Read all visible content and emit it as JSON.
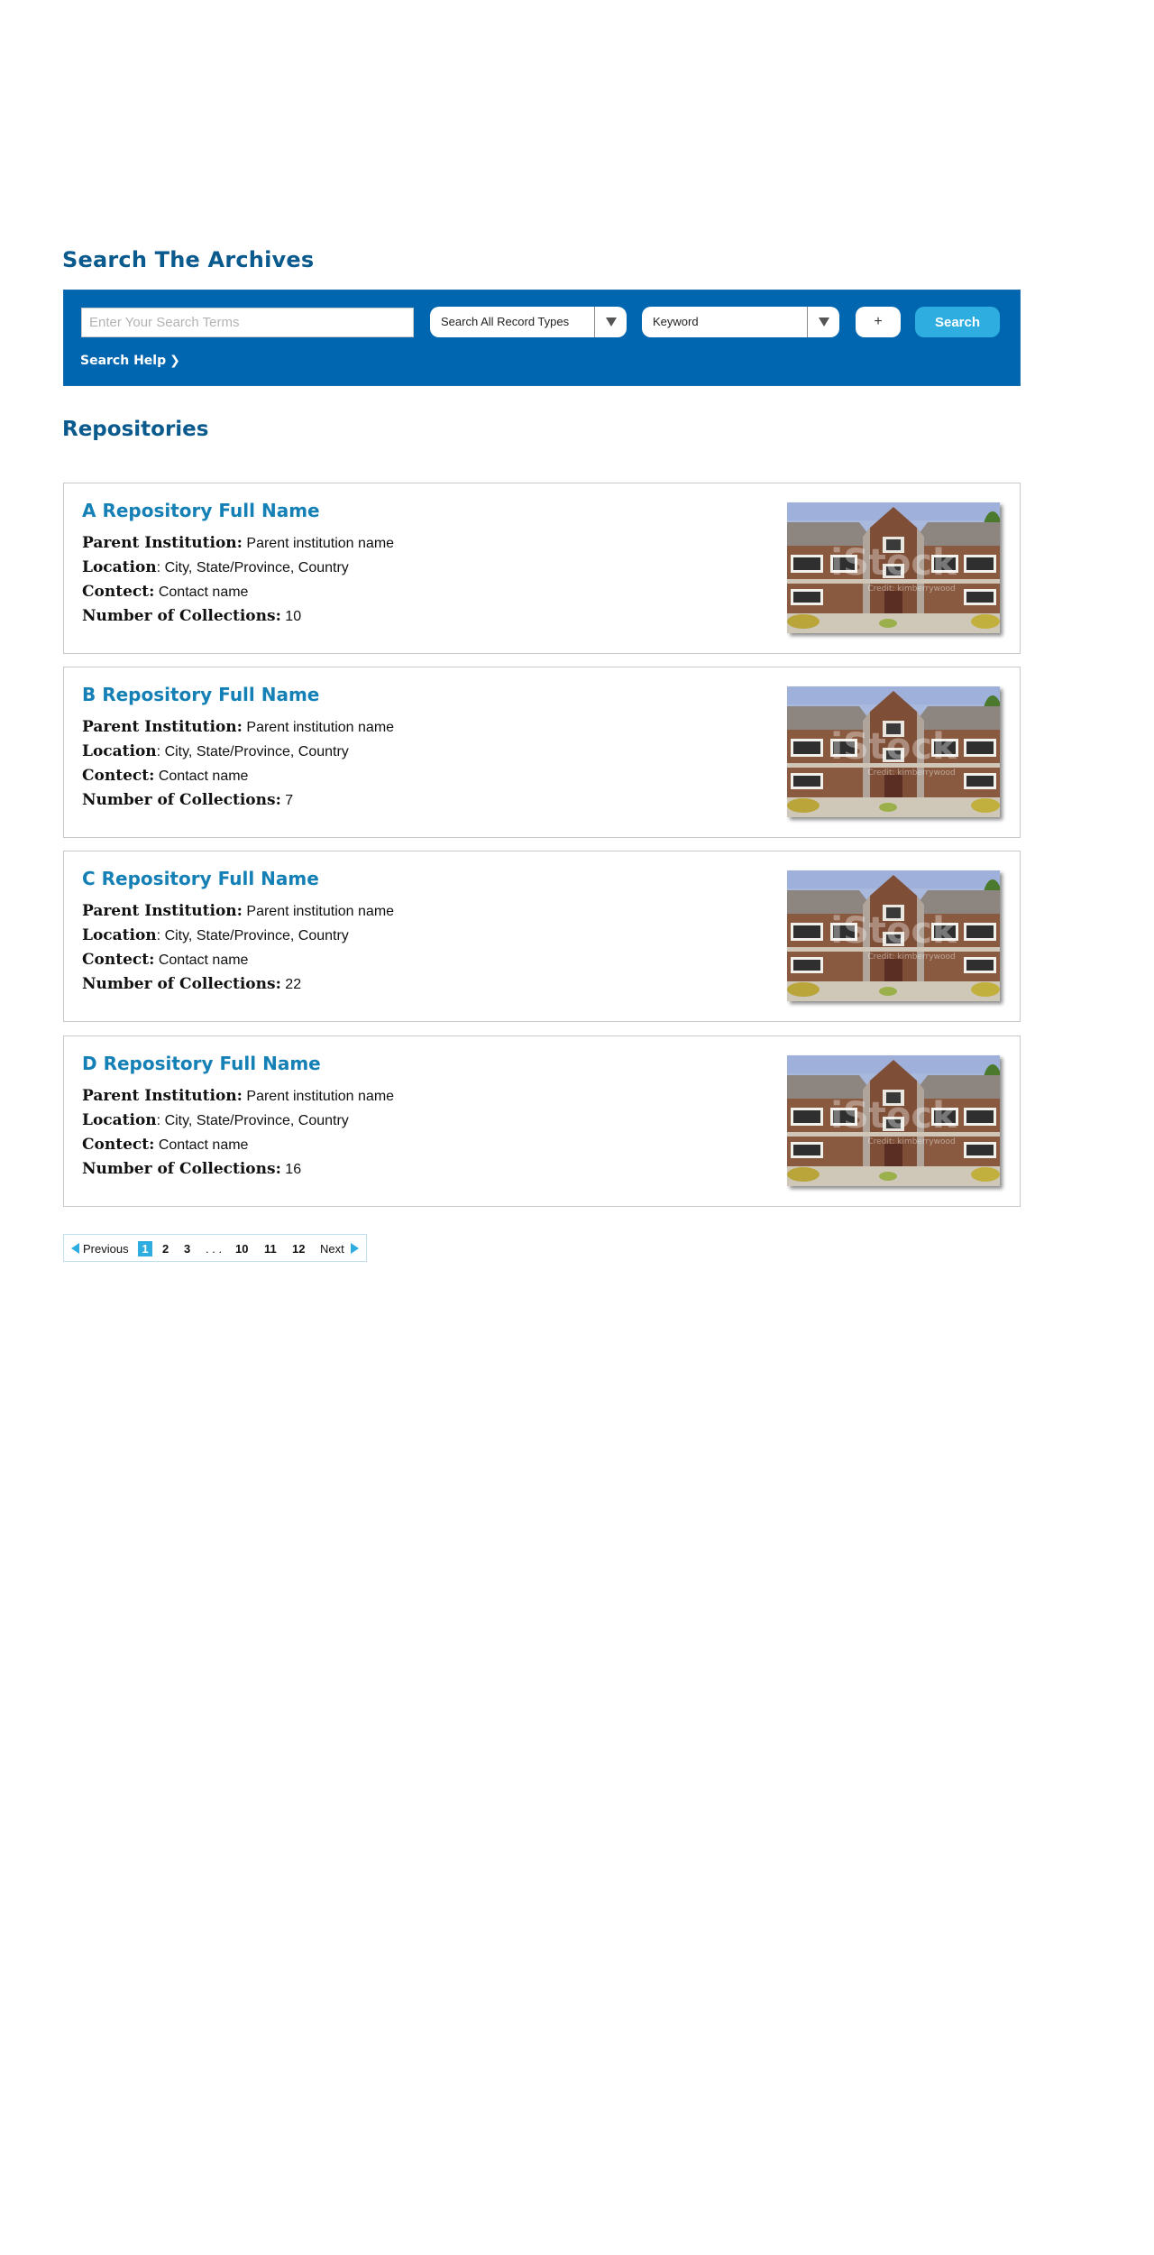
{
  "page_title": "Search The Archives",
  "search": {
    "placeholder": "Enter Your Search Terms",
    "value": "",
    "record_type": "Search All Record Types",
    "field": "Keyword",
    "add_label": "+",
    "button_label": "Search",
    "help_label": "Search Help",
    "help_chevron": "❯"
  },
  "section_title": "Repositories",
  "labels": {
    "parent": "Parent Institution:",
    "location": "Location",
    "contact": "Contect:",
    "collections": "Number of Collections:"
  },
  "repositories": [
    {
      "name": "A Repository Full Name",
      "parent": "Parent institution name",
      "location": ": City, State/Province, Country",
      "contact": "Contact name",
      "collections": "10"
    },
    {
      "name": "B Repository Full Name",
      "parent": "Parent institution name",
      "location": ": City, State/Province, Country",
      "contact": "Contact name",
      "collections": "7"
    },
    {
      "name": "C Repository Full Name",
      "parent": "Parent institution name",
      "location": ": City, State/Province, Country",
      "contact": "Contact name",
      "collections": "22"
    },
    {
      "name": "D Repository Full Name",
      "parent": "Parent institution name",
      "location": ": City, State/Province, Country",
      "contact": "Contact name",
      "collections": "16"
    }
  ],
  "photo_watermark": "iStock",
  "photo_watermark_sub": "Credit: kimberrywood",
  "pagination": {
    "previous": "Previous",
    "pages": [
      "1",
      "2",
      "3",
      ". . .",
      "10",
      "11",
      "12"
    ],
    "next": "Next"
  },
  "colors": {
    "brand_blue": "#0066b0",
    "title_blue": "#0b5a8e",
    "link_blue": "#1480b5",
    "accent": "#2eaee0"
  },
  "icons": [
    "chevron-right-icon",
    "dropdown-arrow-icon",
    "prev-arrow-icon",
    "next-arrow-icon"
  ]
}
